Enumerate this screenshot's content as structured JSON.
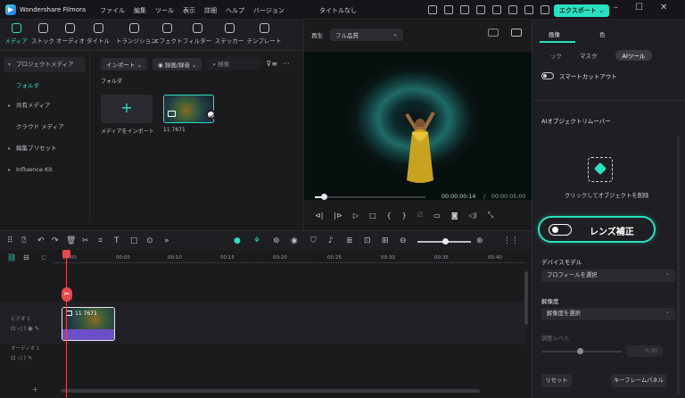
{
  "app": {
    "name": "Wondershare Filmora",
    "doc_title": "タイトルなし",
    "export_label": "エクスポート"
  },
  "menu": [
    "ファイル",
    "編集",
    "ツール",
    "表示",
    "詳細",
    "ヘルプ",
    "バージョン"
  ],
  "media_tools": [
    {
      "label": "メディア",
      "icon": "media-icon",
      "active": true
    },
    {
      "label": "ストック",
      "icon": "stock-icon"
    },
    {
      "label": "オーディオ",
      "icon": "audio-icon"
    },
    {
      "label": "タイトル",
      "icon": "title-icon"
    },
    {
      "label": "トランジション",
      "icon": "transition-icon"
    },
    {
      "label": "エフェクト",
      "icon": "effect-icon"
    },
    {
      "label": "フィルター",
      "icon": "filter-icon"
    },
    {
      "label": "ステッカー",
      "icon": "sticker-icon"
    },
    {
      "label": "テンプレート",
      "icon": "template-icon"
    }
  ],
  "sidebar": {
    "items": [
      {
        "label": "プロジェクトメディア",
        "caret": "▾"
      },
      {
        "label": "フォルダ",
        "caret": ""
      },
      {
        "label": "共有メディア",
        "caret": "▸"
      },
      {
        "label": "クラウド メディア",
        "caret": ""
      },
      {
        "label": "編集プリセット",
        "caret": "▸"
      },
      {
        "label": "Influence Kit",
        "caret": "▸"
      }
    ]
  },
  "media": {
    "import_dropdown": "インポート",
    "record_dropdown": "録画/録音",
    "search_placeholder": "検索",
    "folder_label": "フォルダ",
    "import_tile_label": "メディアをインポート",
    "clip_name": "11 7671"
  },
  "player": {
    "tab": "再生",
    "quality": "フル品質",
    "current_time": "00:00:00:14",
    "total_time": "00:00:05:00",
    "progress": 0.08
  },
  "right_panel": {
    "tabs": [
      "画像",
      "色"
    ],
    "subtabs": [
      "ック",
      "マスク",
      "AIツール"
    ],
    "smart_cutout": "スマートカットアウト",
    "ai_remover": "AIオブジェクトリムーバー",
    "remove_hint": "クリックしてオブジェクトを削除",
    "lens_label": "レンズ補正",
    "device_model_label": "デバイスモデル",
    "device_model_value": "プロフィールを選択",
    "resolution_label": "解像度",
    "resolution_value": "解像度を選択",
    "adjust_label": "調整レベル",
    "adjust_value": "0.00",
    "reset_label": "リセット",
    "keyframe_label": "キーフレームパネル"
  },
  "timeline": {
    "ruler": [
      "00:00",
      "00:05",
      "00:10",
      "00:15",
      "00:20",
      "00:25",
      "00:30",
      "00:35",
      "00:40"
    ],
    "video_track": "ビデオ 1",
    "audio_track": "オーディオ 1",
    "clip_name": "11 7671"
  },
  "colors": {
    "accent": "#2ae0c2",
    "playhead": "#e8484c",
    "bg": "#1b1b1e"
  }
}
